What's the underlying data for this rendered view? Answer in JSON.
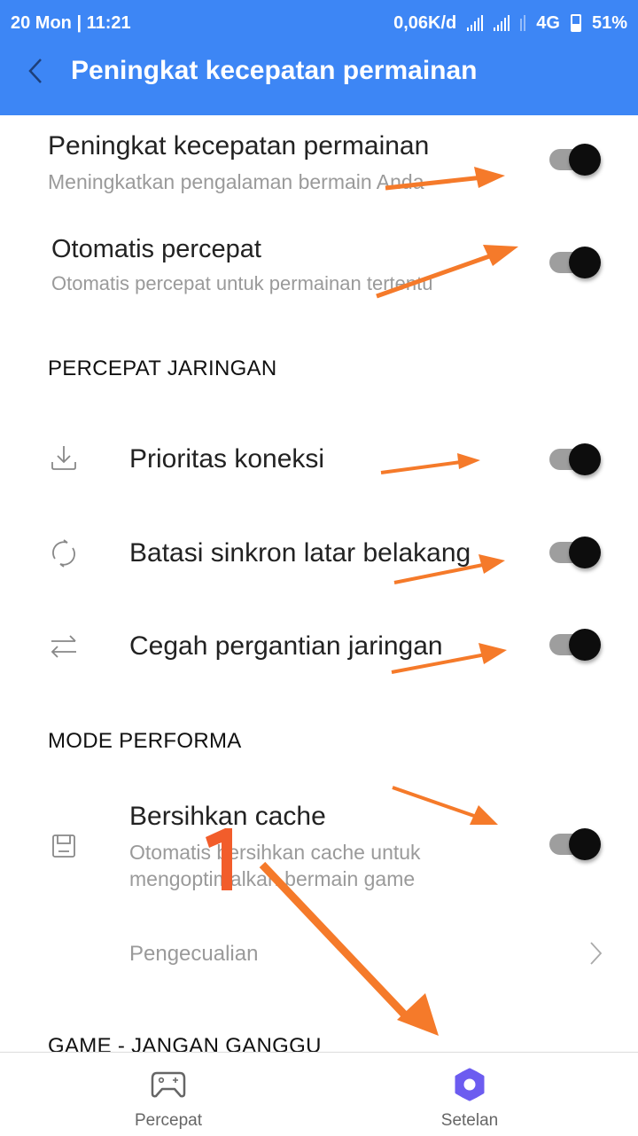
{
  "status_bar": {
    "date_time": "20 Mon | 11:21",
    "net_speed": "0,06K/d",
    "network_type": "4G",
    "battery": "51%",
    "icons": [
      "signal-icon",
      "signal-icon",
      "data-arrows-icon",
      "battery-icon"
    ]
  },
  "header": {
    "back_icon": "chevron-left-icon",
    "title": "Peningkat kecepatan permainan"
  },
  "colors": {
    "header_bg": "#3d86f5",
    "accent": "#6c5cf0",
    "annotation": "#f57a2a",
    "toggle_knob": "#0d0d0d",
    "toggle_track": "#9e9e9e"
  },
  "settings": {
    "main": [
      {
        "title": "Peningkat kecepatan permainan",
        "subtitle": "Meningkatkan pengalaman bermain Anda",
        "enabled": true
      },
      {
        "title": "Otomatis percepat",
        "subtitle": "Otomatis percepat untuk permainan tertentu",
        "enabled": true
      }
    ],
    "network_section": {
      "header": "PERCEPAT JARINGAN",
      "items": [
        {
          "icon": "download-icon",
          "title": "Prioritas koneksi",
          "enabled": true
        },
        {
          "icon": "sync-icon",
          "title": "Batasi sinkron latar belakang",
          "enabled": true
        },
        {
          "icon": "swap-arrows-icon",
          "title": "Cegah pergantian jaringan",
          "enabled": true
        }
      ]
    },
    "performance_section": {
      "header": "MODE PERFORMA",
      "items": [
        {
          "icon": "save-icon",
          "title": "Bersihkan cache",
          "subtitle_line1": "Otomatis bersihkan cache untuk",
          "subtitle_line2": "mengoptimalkan bermain game",
          "enabled": true
        }
      ],
      "exceptions_label": "Pengecualian"
    },
    "dnd_section": {
      "header": "GAME - JANGAN GANGGU"
    }
  },
  "annotations": {
    "step_number": "1"
  },
  "bottom_nav": {
    "items": [
      {
        "icon": "gamepad-icon",
        "label": "Percepat",
        "active": false
      },
      {
        "icon": "gear-icon",
        "label": "Setelan",
        "active": true
      }
    ]
  }
}
